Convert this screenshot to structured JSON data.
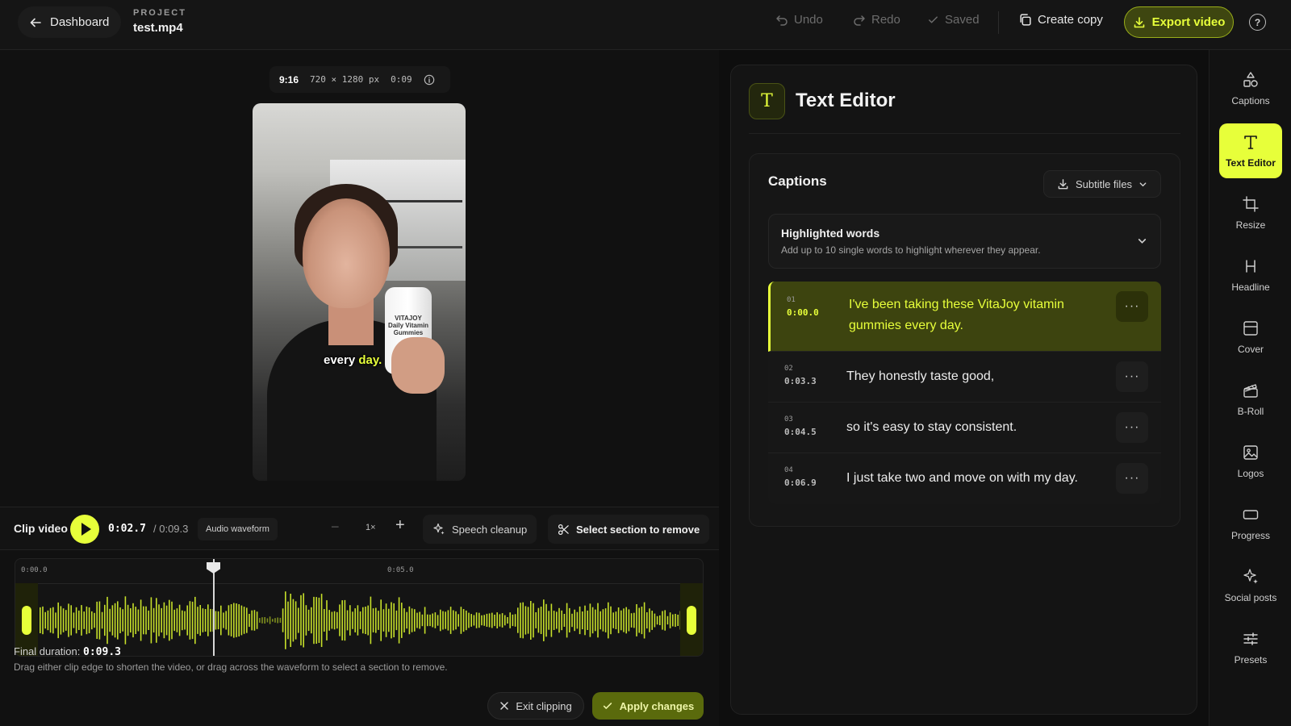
{
  "topbar": {
    "back_label": "Dashboard",
    "project_label": "PROJECT",
    "project_file": "test.mp4",
    "undo": "Undo",
    "redo": "Redo",
    "saved": "Saved",
    "create_copy": "Create copy",
    "export": "Export video",
    "help_glyph": "?"
  },
  "preview": {
    "ratio": "9:16",
    "resolution": "720 × 1280 px",
    "duration": "0:09",
    "caption_prefix": "every ",
    "caption_highlight": "day.",
    "bottle_label": "VITAJOY Daily Vitamin Gummies"
  },
  "clip_bar": {
    "title": "Clip video",
    "current_time": "0:02.7",
    "total_time": "/ 0:09.3",
    "waveform_chip": "Audio waveform",
    "zoom_minus": "−",
    "zoom_value": "1×",
    "zoom_plus": "+",
    "speech_cleanup": "Speech cleanup",
    "select_remove": "Select section to remove"
  },
  "timeline": {
    "label_start": "0:00.0",
    "label_mid": "0:05.0",
    "playhead_time_sec": 2.7,
    "total_sec": 9.3
  },
  "footer": {
    "final_label": "Final duration:",
    "final_value": "0:09.3",
    "hint": "Drag either clip edge to shorten the video, or drag across the waveform to select a section to remove.",
    "exit": "Exit clipping",
    "apply": "Apply changes"
  },
  "panel": {
    "icon_glyph": "T",
    "title": "Text Editor",
    "captions_title": "Captions",
    "subtitle_files": "Subtitle files",
    "highlight_title": "Highlighted words",
    "highlight_sub": "Add up to 10 single words to highlight wherever they appear.",
    "more_glyph": "···",
    "rows": [
      {
        "num": "01",
        "time": "0:00.0",
        "text": "I've been taking these VitaJoy vitamin gummies every day."
      },
      {
        "num": "02",
        "time": "0:03.3",
        "text": "They honestly taste good,"
      },
      {
        "num": "03",
        "time": "0:04.5",
        "text": "so it's easy to stay consistent."
      },
      {
        "num": "04",
        "time": "0:06.9",
        "text": "I just take two and move on with my day."
      }
    ]
  },
  "rail": [
    {
      "label": "Captions",
      "icon": "shapes-icon"
    },
    {
      "label": "Text Editor",
      "icon": "text-icon"
    },
    {
      "label": "Resize",
      "icon": "crop-icon"
    },
    {
      "label": "Headline",
      "icon": "heading-icon"
    },
    {
      "label": "Cover",
      "icon": "cover-icon"
    },
    {
      "label": "B-Roll",
      "icon": "clapper-icon"
    },
    {
      "label": "Logos",
      "icon": "image-icon"
    },
    {
      "label": "Progress",
      "icon": "progress-icon"
    },
    {
      "label": "Social posts",
      "icon": "sparkle-icon"
    },
    {
      "label": "Presets",
      "icon": "sliders-icon"
    }
  ],
  "colors": {
    "accent": "#e7ff3a",
    "accent_dark": "#3d440f",
    "background": "#0e0e0e"
  }
}
